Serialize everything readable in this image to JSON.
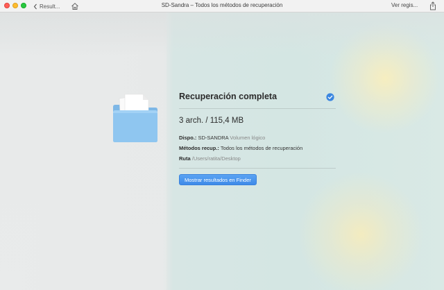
{
  "window": {
    "back_label": "Result...",
    "title": "SD-Sandra – Todos los métodos de recuperación",
    "ver_registro": "Ver regis..."
  },
  "card": {
    "title": "Recuperación completa",
    "summary": "3 arch. / 115,4 MB",
    "device_key": "Dispo.:",
    "device_value": "SD-SANDRA",
    "device_sub": "Volumen lógico",
    "methods_key": "Métodos recup.:",
    "methods_value": "Todos los métodos de recuperación",
    "path_key": "Ruta",
    "path_value": "/Users/ratita/Desktop",
    "button_label": "Mostrar resultados en Finder"
  },
  "colors": {
    "accent": "#3e8ae8",
    "folder": "#8cc3ee",
    "check": "#3b86e0"
  },
  "icons": [
    "back-chevron-icon",
    "home-icon",
    "share-icon",
    "folder-icon",
    "check-circle-icon"
  ]
}
